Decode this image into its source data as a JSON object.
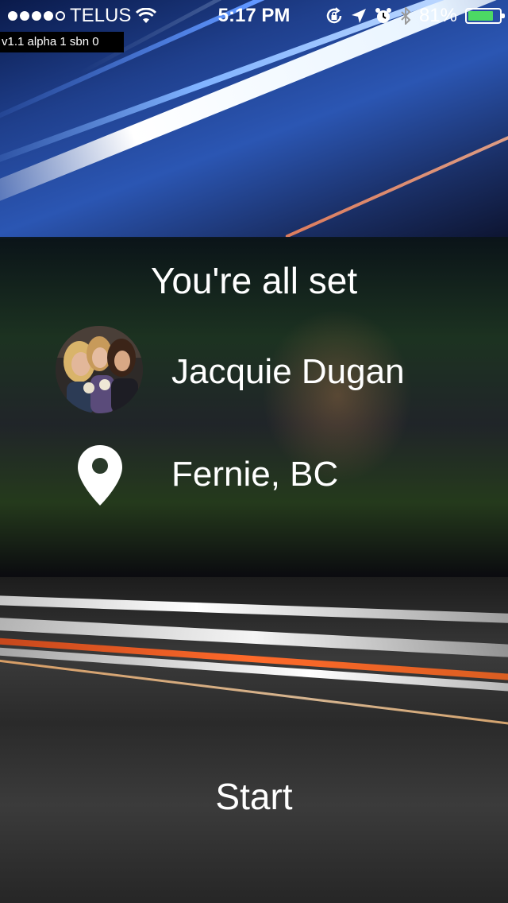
{
  "status_bar": {
    "carrier": "TELUS",
    "time": "5:17 PM",
    "battery_percent": "81%",
    "battery_level": 0.81,
    "signal_bars_filled": 4,
    "signal_bars_total": 5,
    "icons": [
      "wifi-icon",
      "rotation-lock-icon",
      "location-arrow-icon",
      "alarm-icon",
      "bluetooth-icon",
      "battery-icon"
    ]
  },
  "version_badge": "v1.1 alpha 1 sbn 0",
  "panel": {
    "title": "You're all set",
    "user_name": "Jacquie Dugan",
    "location": "Fernie, BC",
    "location_icon": "map-pin-icon"
  },
  "start_label": "Start",
  "colors": {
    "battery_fill": "#4cd964",
    "text": "#ffffff"
  }
}
